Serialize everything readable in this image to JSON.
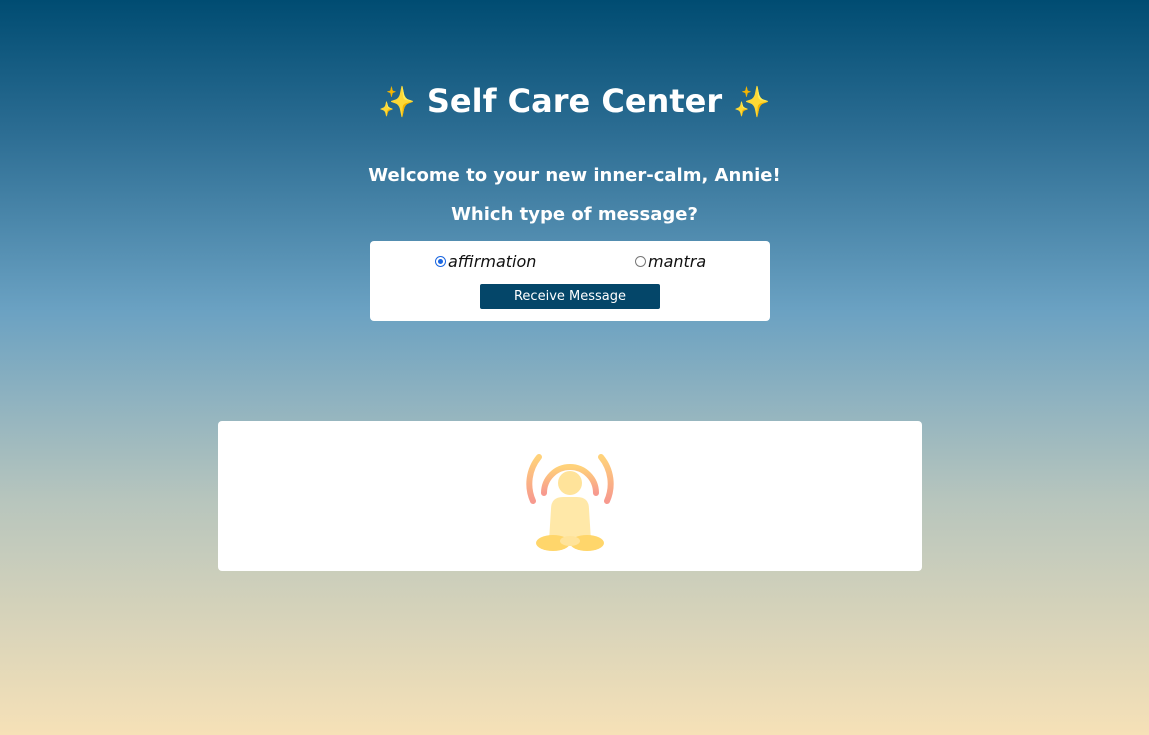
{
  "header": {
    "title": "Self Care Center",
    "sparkle_left": "✨",
    "sparkle_right": "✨"
  },
  "intro": {
    "welcome": "Welcome to your new inner-calm, Annie!",
    "question": "Which type of message?"
  },
  "form": {
    "options": [
      {
        "label": "affirmation",
        "selected": true
      },
      {
        "label": "mantra",
        "selected": false
      }
    ],
    "submit_label": "Receive Message"
  },
  "message_panel": {
    "icon": "meditation-icon"
  },
  "colors": {
    "background_top": "#004c72",
    "background_bottom": "#f6e1b7",
    "button": "#044669",
    "radio_accent": "#1a66e0",
    "icon_yellow": "#ffe39a",
    "icon_ring": "#f8a38a"
  }
}
